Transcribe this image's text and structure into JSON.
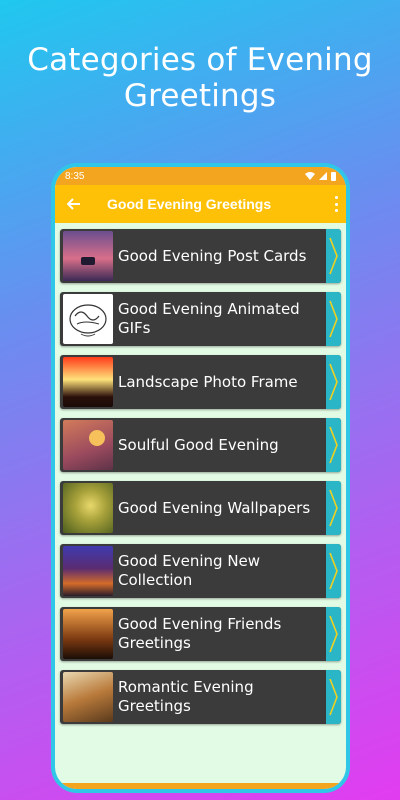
{
  "promo": {
    "title": "Categories of Evening Greetings"
  },
  "status": {
    "time": "8:35"
  },
  "appbar": {
    "title": "Good Evening Greetings"
  },
  "items": [
    {
      "label": "Good Evening Post Cards",
      "icon": "sunset-boat-thumbnail"
    },
    {
      "label": "Good Evening Animated GIFs",
      "icon": "good-evening-calligraphy-thumbnail"
    },
    {
      "label": "Landscape Photo Frame",
      "icon": "sunset-frame-thumbnail"
    },
    {
      "label": "Soulful Good Evening",
      "icon": "birds-sunset-thumbnail"
    },
    {
      "label": "Good Evening Wallpapers",
      "icon": "flower-thumbnail"
    },
    {
      "label": "Good Evening New Collection",
      "icon": "have-a-great-evening-thumbnail"
    },
    {
      "label": "Good Evening Friends Greetings",
      "icon": "evening-sunset-thumbnail"
    },
    {
      "label": "Romantic Evening Greetings",
      "icon": "autumn-tree-thumbnail"
    }
  ],
  "colors": {
    "statusbar": "#f3a51f",
    "appbar": "#ffc107",
    "list_background": "#e2fbe4",
    "item_background": "#3b3b3b",
    "arrow_tab": "#2ab6c6",
    "arrow_chevron": "#f0d020"
  }
}
